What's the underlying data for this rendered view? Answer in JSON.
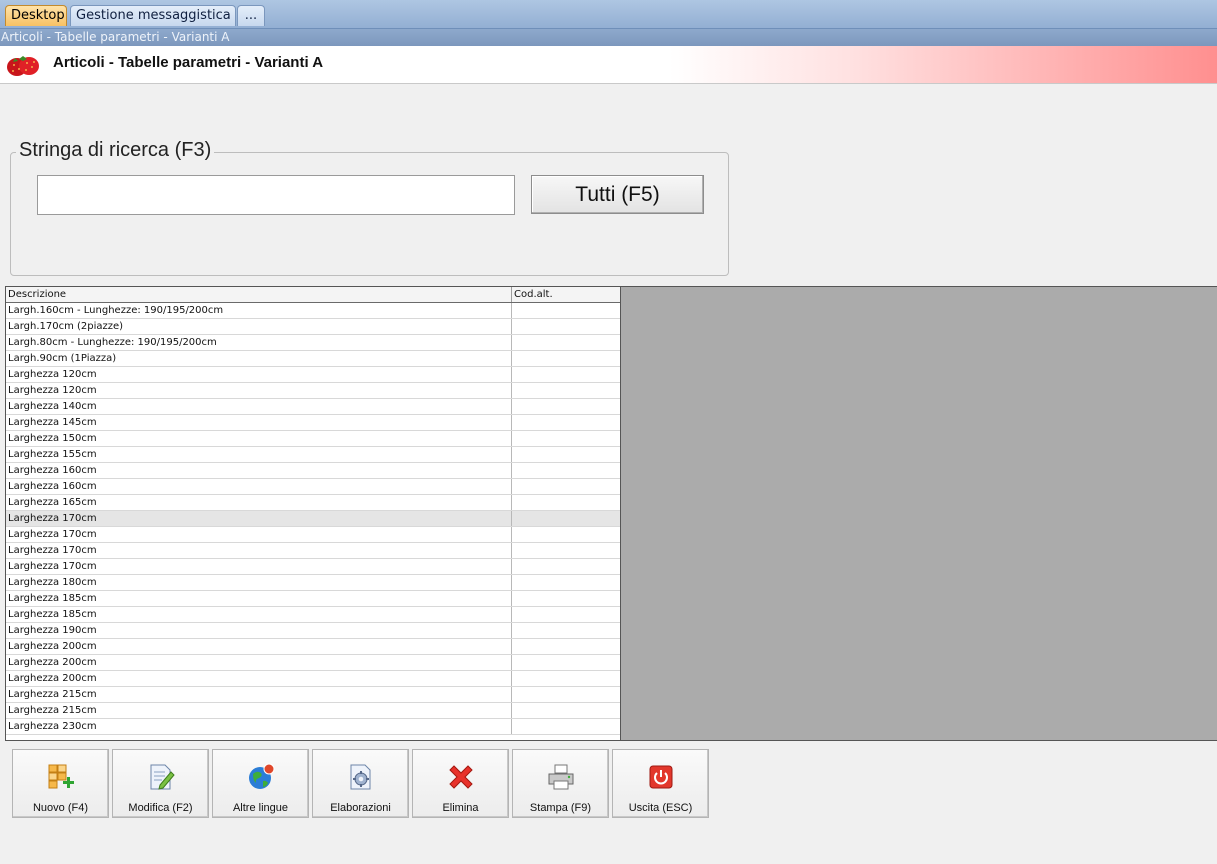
{
  "tabs": [
    {
      "label": "Desktop",
      "active": true
    },
    {
      "label": "Gestione messaggistica",
      "active": false
    },
    {
      "label": "...",
      "active": false
    }
  ],
  "window": {
    "title": "Articoli - Tabelle parametri - Varianti A"
  },
  "header": {
    "title": "Articoli - Tabelle parametri - Varianti A",
    "icon": "strawberry-icon"
  },
  "search": {
    "legend": "Stringa di ricerca (F3)",
    "value": "",
    "all_button": "Tutti (F5)"
  },
  "grid": {
    "columns": [
      "Descrizione",
      "Cod.alt."
    ],
    "selected_index": 13,
    "rows": [
      [
        "Largh.160cm - Lunghezze: 190/195/200cm",
        ""
      ],
      [
        "Largh.170cm (2piazze)",
        ""
      ],
      [
        "Largh.80cm - Lunghezze: 190/195/200cm",
        ""
      ],
      [
        "Largh.90cm (1Piazza)",
        ""
      ],
      [
        "Larghezza 120cm",
        ""
      ],
      [
        "Larghezza 120cm",
        ""
      ],
      [
        "Larghezza 140cm",
        ""
      ],
      [
        "Larghezza 145cm",
        ""
      ],
      [
        "Larghezza 150cm",
        ""
      ],
      [
        "Larghezza 155cm",
        ""
      ],
      [
        "Larghezza 160cm",
        ""
      ],
      [
        "Larghezza 160cm",
        ""
      ],
      [
        "Larghezza 165cm",
        ""
      ],
      [
        "Larghezza 170cm",
        ""
      ],
      [
        "Larghezza 170cm",
        ""
      ],
      [
        "Larghezza 170cm",
        ""
      ],
      [
        "Larghezza 170cm",
        ""
      ],
      [
        "Larghezza 180cm",
        ""
      ],
      [
        "Larghezza 185cm",
        ""
      ],
      [
        "Larghezza 185cm",
        ""
      ],
      [
        "Larghezza 190cm",
        ""
      ],
      [
        "Larghezza 200cm",
        ""
      ],
      [
        "Larghezza 200cm",
        ""
      ],
      [
        "Larghezza 200cm",
        ""
      ],
      [
        "Larghezza 215cm",
        ""
      ],
      [
        "Larghezza 215cm",
        ""
      ],
      [
        "Larghezza 230cm",
        ""
      ]
    ]
  },
  "toolbar": {
    "new": "Nuovo (F4)",
    "edit": "Modifica (F2)",
    "languages": "Altre lingue",
    "processing": "Elaborazioni",
    "delete": "Elimina",
    "print": "Stampa (F9)",
    "exit": "Uscita (ESC)"
  },
  "colors": {
    "active_tab": "#f7c163",
    "tabstrip": "#93afd3",
    "grid_empty_area": "#ababab",
    "selected_row": "#e5e5e5"
  }
}
